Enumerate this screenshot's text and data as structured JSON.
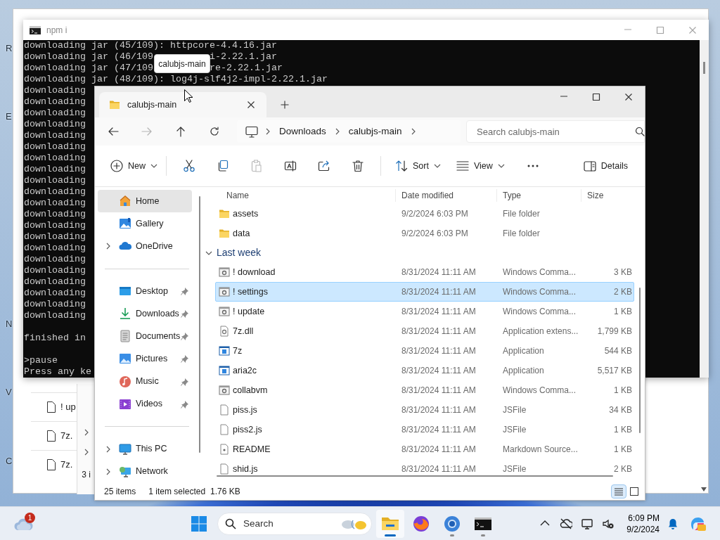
{
  "desktop": {
    "icon_labels": [
      "R",
      "E",
      "N",
      "V",
      "C"
    ]
  },
  "background_window": {
    "rows": [
      {
        "name": "! up"
      },
      {
        "name": "7z."
      },
      {
        "name": "7z."
      }
    ],
    "status": "3 i"
  },
  "terminal": {
    "title": "npm i",
    "lines": [
      {
        "kind": "text",
        "parts": [
          "downloading jar (45/109): httpcore-4.4.16.jar"
        ]
      },
      {
        "kind": "text",
        "parts": [
          "downloading jar (46/109",
          "i-2.22.1.jar"
        ]
      },
      {
        "kind": "text",
        "parts": [
          "downloading jar (47/109",
          "re-2.22.1.jar"
        ]
      },
      {
        "kind": "text",
        "parts": [
          "downloading jar (48/109): log4j-slf4j2-impl-2.22.1.jar"
        ]
      },
      {
        "kind": "text",
        "parts": [
          "downloading"
        ]
      },
      {
        "kind": "text",
        "parts": [
          "downloading"
        ]
      },
      {
        "kind": "text",
        "parts": [
          "downloading"
        ]
      },
      {
        "kind": "text",
        "parts": [
          "downloading"
        ]
      },
      {
        "kind": "text",
        "parts": [
          "downloading"
        ]
      },
      {
        "kind": "text",
        "parts": [
          "downloading"
        ]
      },
      {
        "kind": "text",
        "parts": [
          "downloading"
        ]
      },
      {
        "kind": "text",
        "parts": [
          "downloading"
        ]
      },
      {
        "kind": "text",
        "parts": [
          "downloading"
        ]
      },
      {
        "kind": "text",
        "parts": [
          "downloading"
        ]
      },
      {
        "kind": "text",
        "parts": [
          "downloading"
        ]
      },
      {
        "kind": "text",
        "parts": [
          "downloading"
        ]
      },
      {
        "kind": "text",
        "parts": [
          "downloading"
        ]
      },
      {
        "kind": "text",
        "parts": [
          "downloading"
        ]
      },
      {
        "kind": "text",
        "parts": [
          "downloading"
        ]
      },
      {
        "kind": "text",
        "parts": [
          "downloading"
        ]
      },
      {
        "kind": "text",
        "parts": [
          "downloading"
        ]
      },
      {
        "kind": "text",
        "parts": [
          "downloading"
        ]
      },
      {
        "kind": "text",
        "parts": [
          "downloading"
        ]
      },
      {
        "kind": "text",
        "parts": [
          "downloading"
        ]
      },
      {
        "kind": "text",
        "parts": [
          "downloading"
        ]
      },
      {
        "kind": "blank"
      },
      {
        "kind": "text",
        "parts": [
          "finished in"
        ]
      },
      {
        "kind": "blank"
      },
      {
        "kind": "text",
        "parts": [
          ">pause"
        ]
      },
      {
        "kind": "text",
        "parts": [
          "Press any ke"
        ]
      }
    ]
  },
  "tooltip": {
    "text": "calubjs-main"
  },
  "explorer": {
    "tab": {
      "title": "calubjs-main"
    },
    "forward": {
      "disabled": true
    },
    "breadcrumb": [
      "Downloads",
      "calubjs-main"
    ],
    "search": {
      "placeholder": "Search calubjs-main"
    },
    "toolbar": {
      "new": "New",
      "paste": {
        "disabled": true
      },
      "sort": "Sort",
      "view": "View",
      "details": "Details"
    },
    "nav_groups": [
      [
        {
          "label": "Home",
          "selected": true,
          "pinned": false,
          "expandable": false
        },
        {
          "label": "Gallery",
          "selected": false,
          "pinned": false,
          "expandable": false
        },
        {
          "label": "OneDrive",
          "selected": false,
          "pinned": false,
          "expandable": true
        }
      ],
      [
        {
          "label": "Desktop",
          "selected": false,
          "pinned": true,
          "expandable": false
        },
        {
          "label": "Downloads",
          "selected": false,
          "pinned": true,
          "expandable": false
        },
        {
          "label": "Documents",
          "selected": false,
          "pinned": true,
          "expandable": false
        },
        {
          "label": "Pictures",
          "selected": false,
          "pinned": true,
          "expandable": false
        },
        {
          "label": "Music",
          "selected": false,
          "pinned": true,
          "expandable": false
        },
        {
          "label": "Videos",
          "selected": false,
          "pinned": true,
          "expandable": false
        }
      ],
      [
        {
          "label": "This PC",
          "selected": false,
          "pinned": false,
          "expandable": true
        },
        {
          "label": "Network",
          "selected": false,
          "pinned": false,
          "expandable": true
        }
      ]
    ],
    "columns": [
      "Name",
      "Date modified",
      "Type",
      "Size"
    ],
    "items": [
      {
        "kind": "folder",
        "name": "assets",
        "date": "9/2/2024 6:03 PM",
        "type": "File folder",
        "selected": false
      },
      {
        "kind": "folder",
        "name": "data",
        "date": "9/2/2024 6:03 PM",
        "type": "File folder",
        "selected": false
      },
      {
        "kind": "group",
        "label": "Last week",
        "expanded": true
      },
      {
        "kind": "script",
        "name": "! download",
        "date": "8/31/2024 11:11 AM",
        "type": "Windows Comma...",
        "size": "3 KB",
        "selected": false
      },
      {
        "kind": "script",
        "name": "! settings",
        "date": "8/31/2024 11:11 AM",
        "type": "Windows Comma...",
        "size": "2 KB",
        "selected": true
      },
      {
        "kind": "script",
        "name": "! update",
        "date": "8/31/2024 11:11 AM",
        "type": "Windows Comma...",
        "size": "1 KB",
        "selected": false
      },
      {
        "kind": "library",
        "name": "7z.dll",
        "date": "8/31/2024 11:11 AM",
        "type": "Application extens...",
        "size": "1,799 KB",
        "selected": false
      },
      {
        "kind": "app",
        "name": "7z",
        "date": "8/31/2024 11:11 AM",
        "type": "Application",
        "size": "544 KB",
        "selected": false
      },
      {
        "kind": "app",
        "name": "aria2c",
        "date": "8/31/2024 11:11 AM",
        "type": "Application",
        "size": "5,517 KB",
        "selected": false
      },
      {
        "kind": "script",
        "name": "collabvm",
        "date": "8/31/2024 11:11 AM",
        "type": "Windows Comma...",
        "size": "1 KB",
        "selected": false
      },
      {
        "kind": "file",
        "name": "piss.js",
        "date": "8/31/2024 11:11 AM",
        "type": "JSFile",
        "size": "34 KB",
        "selected": false
      },
      {
        "kind": "file",
        "name": "piss2.js",
        "date": "8/31/2024 11:11 AM",
        "type": "JSFile",
        "size": "1 KB",
        "selected": false
      },
      {
        "kind": "markdown",
        "name": "README",
        "date": "8/31/2024 11:11 AM",
        "type": "Markdown Source...",
        "size": "1 KB",
        "selected": false
      },
      {
        "kind": "file",
        "name": "shid.js",
        "date": "8/31/2024 11:11 AM",
        "type": "JSFile",
        "size": "2 KB",
        "selected": false
      }
    ],
    "status": {
      "count": "25 items",
      "selection": "1 item selected",
      "size": "1.76 KB"
    },
    "view_modes": [
      {
        "selected": true
      },
      {
        "selected": false
      }
    ]
  },
  "taskbar": {
    "weather_badge": "1",
    "search": {
      "placeholder": "Search"
    },
    "apps": [
      {
        "running": true,
        "active": true
      },
      {
        "running": false,
        "active": false
      },
      {
        "running": true,
        "active": false
      },
      {
        "running": true,
        "active": false
      }
    ],
    "time": "6:09 PM",
    "date": "9/2/2024"
  }
}
